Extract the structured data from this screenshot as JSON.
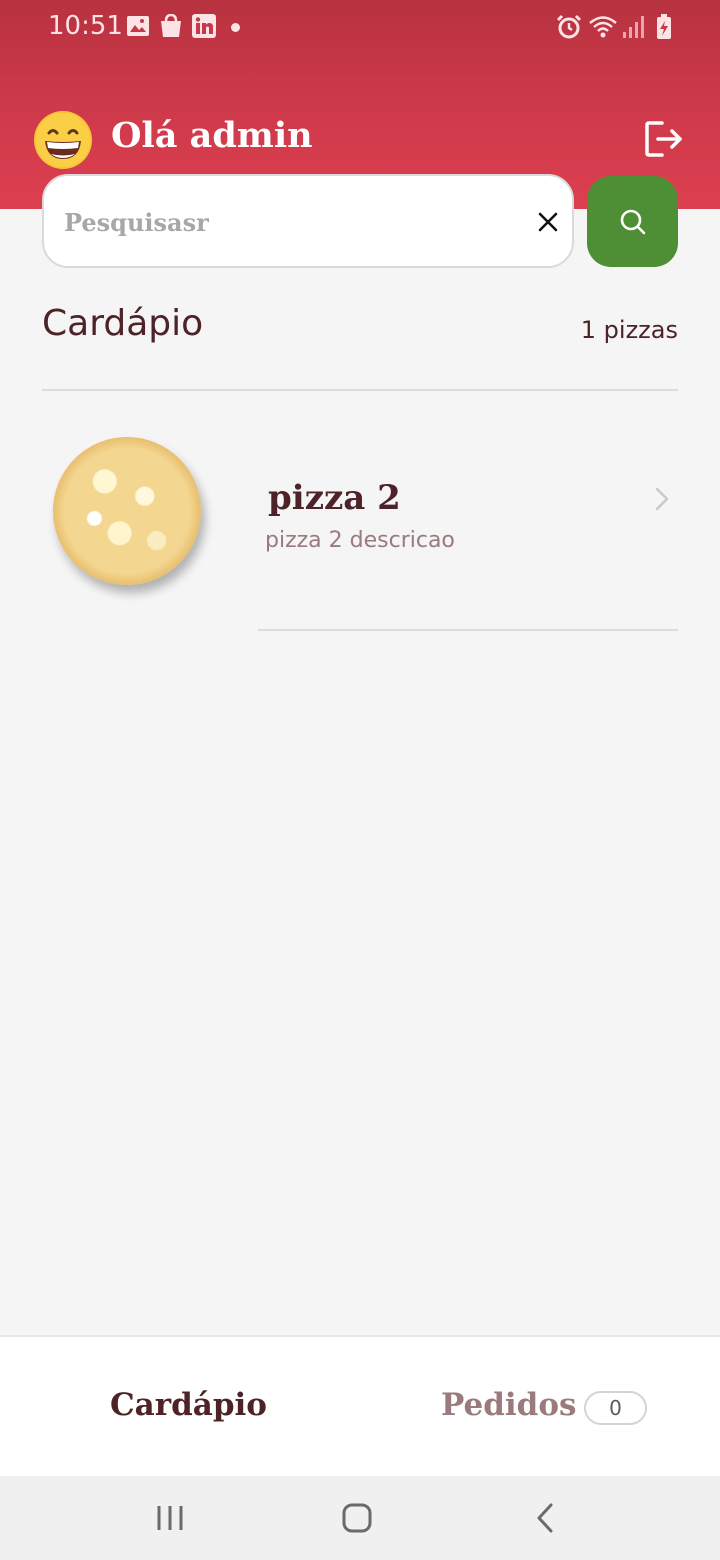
{
  "status_bar": {
    "time": "10:51",
    "left_icons": [
      "image-icon",
      "shopping-bag-icon",
      "linkedin-icon",
      "dot-icon"
    ],
    "right_icons": [
      "alarm-icon",
      "wifi-icon",
      "signal-icon",
      "battery-charging-icon"
    ]
  },
  "header": {
    "avatar_icon": "grinning-face-emoji-icon",
    "greeting": "Olá admin",
    "logout_icon": "logout-icon",
    "background_color": "#d23a4b"
  },
  "search": {
    "placeholder": "Pesquisasr",
    "value": "",
    "clear_icon": "close-icon",
    "button_icon": "search-icon",
    "button_color": "#4e8f35"
  },
  "menu_section": {
    "title": "Cardápio",
    "count": "1 pizzas"
  },
  "pizzas": [
    {
      "name": "pizza 2",
      "description": "pizza 2 descricao"
    }
  ],
  "bottom_nav": {
    "menu_label": "Cardápio",
    "orders_label": "Pedidos",
    "orders_count": "0"
  },
  "system_nav": [
    "recent-apps-icon",
    "home-icon",
    "back-icon"
  ]
}
